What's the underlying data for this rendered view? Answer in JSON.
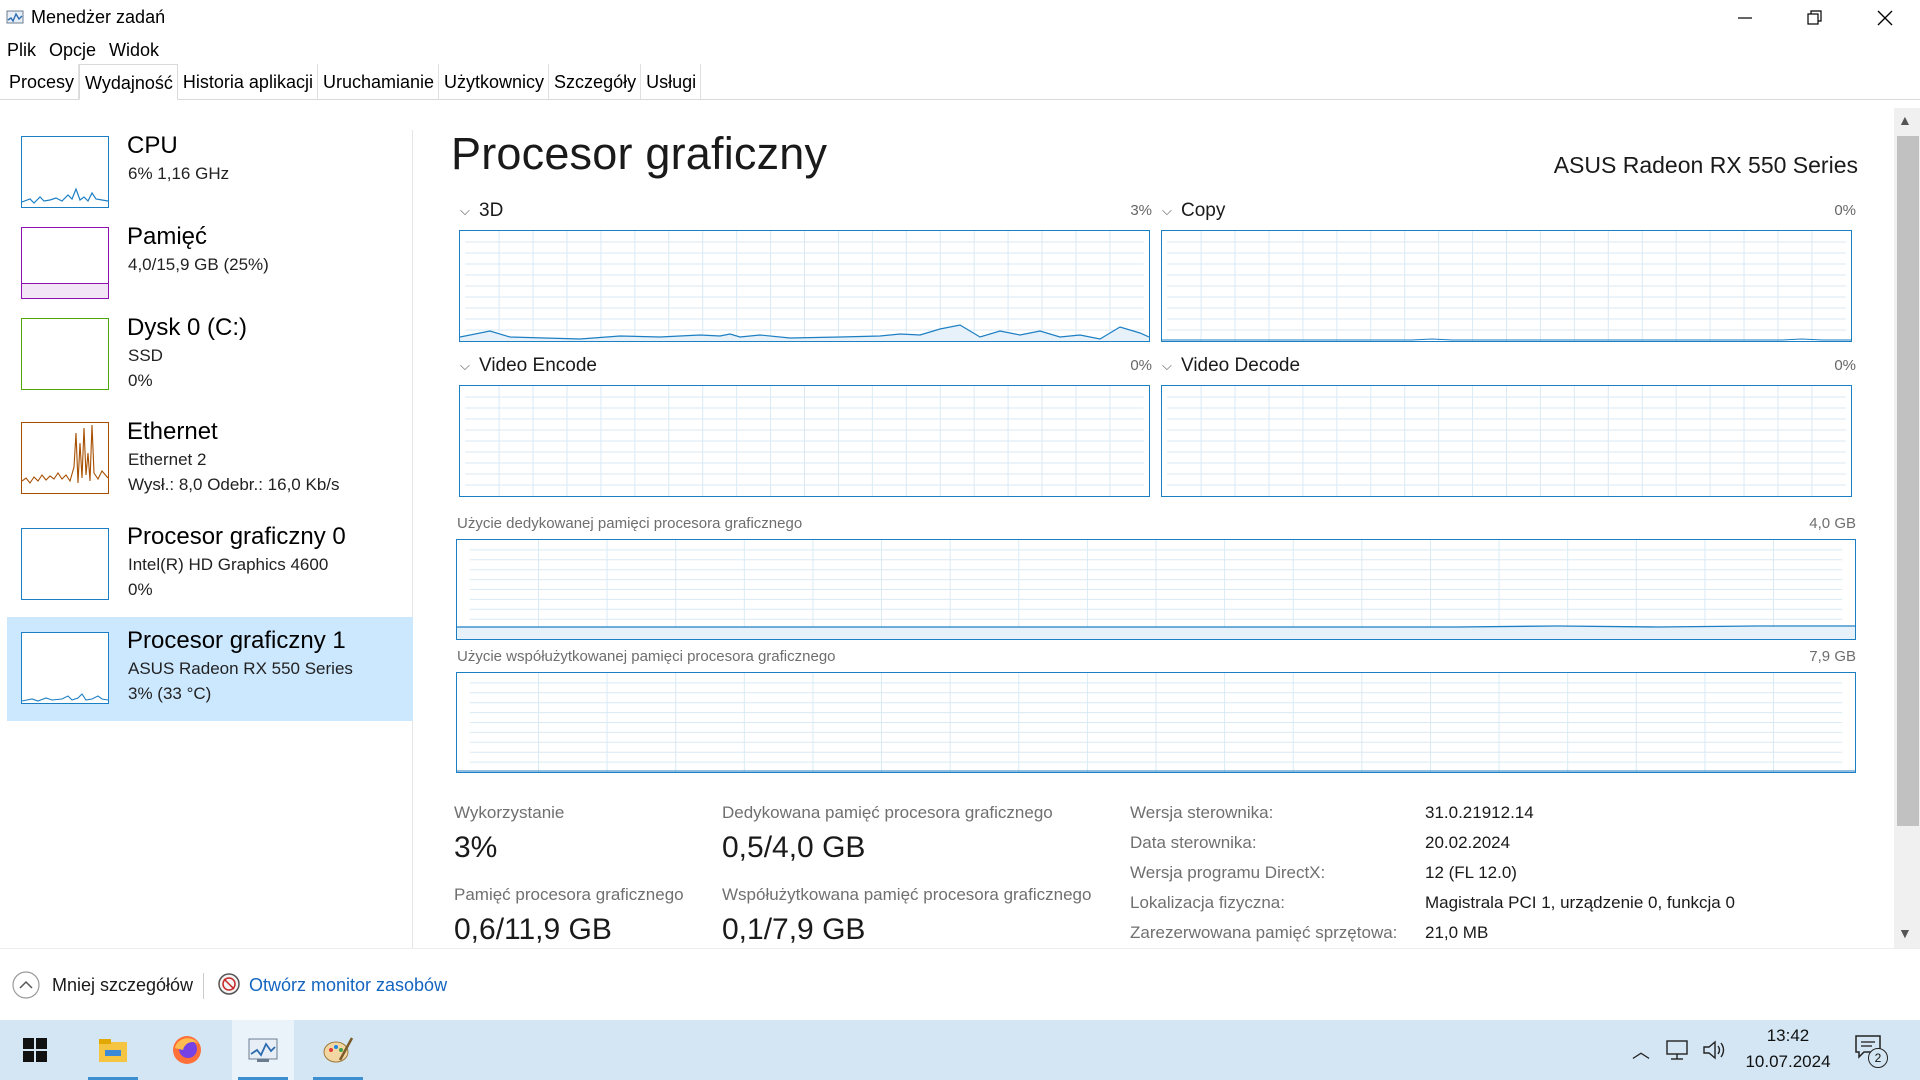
{
  "window": {
    "title": "Menedżer zadań",
    "icons": {
      "app": "task-manager-icon",
      "minimize": "minimize-icon",
      "maximize": "restore-icon",
      "close": "close-icon"
    }
  },
  "menu": [
    "Plik",
    "Opcje",
    "Widok"
  ],
  "tabs": [
    "Procesy",
    "Wydajność",
    "Historia aplikacji",
    "Uruchamianie",
    "Użytkownicy",
    "Szczegóły",
    "Usługi"
  ],
  "active_tab": "Wydajność",
  "sidebar": {
    "items": [
      {
        "title": "CPU",
        "line1": "6%  1,16 GHz",
        "line2": ""
      },
      {
        "title": "Pamięć",
        "line1": "4,0/15,9 GB (25%)",
        "line2": ""
      },
      {
        "title": "Dysk 0 (C:)",
        "line1": "SSD",
        "line2": "0%"
      },
      {
        "title": "Ethernet",
        "line1": "Ethernet 2",
        "line2": "Wysł.: 8,0  Odebr.: 16,0 Kb/s"
      },
      {
        "title": "Procesor graficzny 0",
        "line1": "Intel(R) HD Graphics 4600",
        "line2": "0%"
      },
      {
        "title": "Procesor graficzny 1",
        "line1": "ASUS Radeon RX 550 Series",
        "line2": "3%  (33 °C)"
      }
    ],
    "selected": "Procesor graficzny 1",
    "colors": {
      "cpu": "#1c7fc4",
      "memory": "#8b12ae",
      "disk": "#4da60c",
      "ethernet": "#a74f01",
      "gpu": "#1c7fc4"
    }
  },
  "main": {
    "title": "Procesor graficzny",
    "device": "ASUS Radeon RX 550 Series",
    "engines": [
      {
        "name": "3D",
        "pct": "3%"
      },
      {
        "name": "Copy",
        "pct": "0%"
      },
      {
        "name": "Video Encode",
        "pct": "0%"
      },
      {
        "name": "Video Decode",
        "pct": "0%"
      }
    ],
    "dedicated": {
      "label": "Użycie dedykowanej pamięci procesora graficznego",
      "max": "4,0 GB"
    },
    "shared": {
      "label": "Użycie współużytkowanej pamięci procesora graficznego",
      "max": "7,9 GB"
    },
    "stats": {
      "usage_label": "Wykorzystanie",
      "usage_value": "3%",
      "ded_label": "Dedykowana pamięć procesora graficznego",
      "ded_value": "0,5/4,0 GB",
      "gpu_mem_label": "Pamięć procesora graficznego",
      "gpu_mem_value": "0,6/11,9 GB",
      "shared_label": "Współużytkowana pamięć procesora graficznego",
      "shared_value": "0,1/7,9 GB"
    },
    "details": [
      {
        "label": "Wersja sterownika:",
        "value": "31.0.21912.14"
      },
      {
        "label": "Data sterownika:",
        "value": "20.02.2024"
      },
      {
        "label": "Wersja programu DirectX:",
        "value": "12 (FL 12.0)"
      },
      {
        "label": "Lokalizacja fizyczna:",
        "value": "Magistrala PCI 1, urządzenie 0, funkcja 0"
      },
      {
        "label": "Zarezerwowana pamięć sprzętowa:",
        "value": "21,0 MB"
      }
    ]
  },
  "footer": {
    "less_details": "Mniej szczegółów",
    "resource_monitor": "Otwórz monitor zasobów",
    "icons": {
      "less": "chevron-up-circle-icon",
      "monitor": "resource-monitor-icon"
    }
  },
  "taskbar": {
    "apps": [
      "windows-start-icon",
      "file-explorer-icon",
      "firefox-icon",
      "task-manager-icon",
      "paint-icon"
    ],
    "tray": [
      "chevron-up-icon",
      "network-icon",
      "volume-icon"
    ],
    "time": "13:42",
    "date": "10.07.2024",
    "notifications": "2"
  }
}
